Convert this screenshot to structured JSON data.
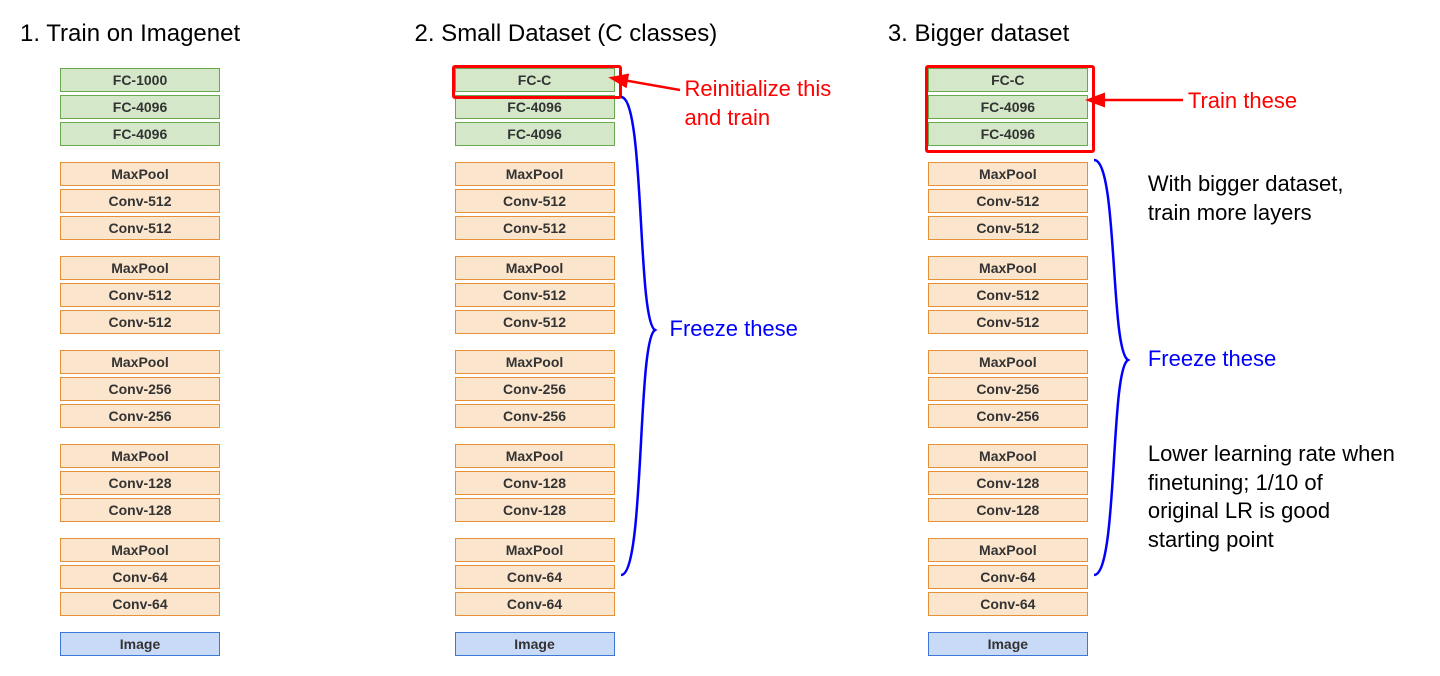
{
  "columns": [
    {
      "heading": "1. Train on Imagenet",
      "layers": [
        {
          "type": "fc",
          "label": "FC-1000"
        },
        {
          "type": "fc",
          "label": "FC-4096"
        },
        {
          "type": "fc",
          "label": "FC-4096"
        },
        {
          "type": "gap"
        },
        {
          "type": "conv",
          "label": "MaxPool"
        },
        {
          "type": "conv",
          "label": "Conv-512"
        },
        {
          "type": "conv",
          "label": "Conv-512"
        },
        {
          "type": "gap"
        },
        {
          "type": "conv",
          "label": "MaxPool"
        },
        {
          "type": "conv",
          "label": "Conv-512"
        },
        {
          "type": "conv",
          "label": "Conv-512"
        },
        {
          "type": "gap"
        },
        {
          "type": "conv",
          "label": "MaxPool"
        },
        {
          "type": "conv",
          "label": "Conv-256"
        },
        {
          "type": "conv",
          "label": "Conv-256"
        },
        {
          "type": "gap"
        },
        {
          "type": "conv",
          "label": "MaxPool"
        },
        {
          "type": "conv",
          "label": "Conv-128"
        },
        {
          "type": "conv",
          "label": "Conv-128"
        },
        {
          "type": "gap"
        },
        {
          "type": "conv",
          "label": "MaxPool"
        },
        {
          "type": "conv",
          "label": "Conv-64"
        },
        {
          "type": "conv",
          "label": "Conv-64"
        },
        {
          "type": "gap"
        },
        {
          "type": "img",
          "label": "Image"
        }
      ]
    },
    {
      "heading": "2. Small Dataset (C classes)",
      "layers": [
        {
          "type": "fc",
          "label": "FC-C"
        },
        {
          "type": "fc",
          "label": "FC-4096"
        },
        {
          "type": "fc",
          "label": "FC-4096"
        },
        {
          "type": "gap"
        },
        {
          "type": "conv",
          "label": "MaxPool"
        },
        {
          "type": "conv",
          "label": "Conv-512"
        },
        {
          "type": "conv",
          "label": "Conv-512"
        },
        {
          "type": "gap"
        },
        {
          "type": "conv",
          "label": "MaxPool"
        },
        {
          "type": "conv",
          "label": "Conv-512"
        },
        {
          "type": "conv",
          "label": "Conv-512"
        },
        {
          "type": "gap"
        },
        {
          "type": "conv",
          "label": "MaxPool"
        },
        {
          "type": "conv",
          "label": "Conv-256"
        },
        {
          "type": "conv",
          "label": "Conv-256"
        },
        {
          "type": "gap"
        },
        {
          "type": "conv",
          "label": "MaxPool"
        },
        {
          "type": "conv",
          "label": "Conv-128"
        },
        {
          "type": "conv",
          "label": "Conv-128"
        },
        {
          "type": "gap"
        },
        {
          "type": "conv",
          "label": "MaxPool"
        },
        {
          "type": "conv",
          "label": "Conv-64"
        },
        {
          "type": "conv",
          "label": "Conv-64"
        },
        {
          "type": "gap"
        },
        {
          "type": "img",
          "label": "Image"
        }
      ],
      "annotations": {
        "reinit_label": "Reinitialize this and train",
        "freeze_label": "Freeze these"
      }
    },
    {
      "heading": "3. Bigger dataset",
      "layers": [
        {
          "type": "fc",
          "label": "FC-C"
        },
        {
          "type": "fc",
          "label": "FC-4096"
        },
        {
          "type": "fc",
          "label": "FC-4096"
        },
        {
          "type": "gap"
        },
        {
          "type": "conv",
          "label": "MaxPool"
        },
        {
          "type": "conv",
          "label": "Conv-512"
        },
        {
          "type": "conv",
          "label": "Conv-512"
        },
        {
          "type": "gap"
        },
        {
          "type": "conv",
          "label": "MaxPool"
        },
        {
          "type": "conv",
          "label": "Conv-512"
        },
        {
          "type": "conv",
          "label": "Conv-512"
        },
        {
          "type": "gap"
        },
        {
          "type": "conv",
          "label": "MaxPool"
        },
        {
          "type": "conv",
          "label": "Conv-256"
        },
        {
          "type": "conv",
          "label": "Conv-256"
        },
        {
          "type": "gap"
        },
        {
          "type": "conv",
          "label": "MaxPool"
        },
        {
          "type": "conv",
          "label": "Conv-128"
        },
        {
          "type": "conv",
          "label": "Conv-128"
        },
        {
          "type": "gap"
        },
        {
          "type": "conv",
          "label": "MaxPool"
        },
        {
          "type": "conv",
          "label": "Conv-64"
        },
        {
          "type": "conv",
          "label": "Conv-64"
        },
        {
          "type": "gap"
        },
        {
          "type": "img",
          "label": "Image"
        }
      ],
      "annotations": {
        "train_label": "Train these",
        "bigger_label": "With bigger dataset, train more layers",
        "freeze_label": "Freeze these",
        "lr_label": "Lower learning rate when finetuning; 1/10 of original LR is good starting point"
      }
    }
  ]
}
